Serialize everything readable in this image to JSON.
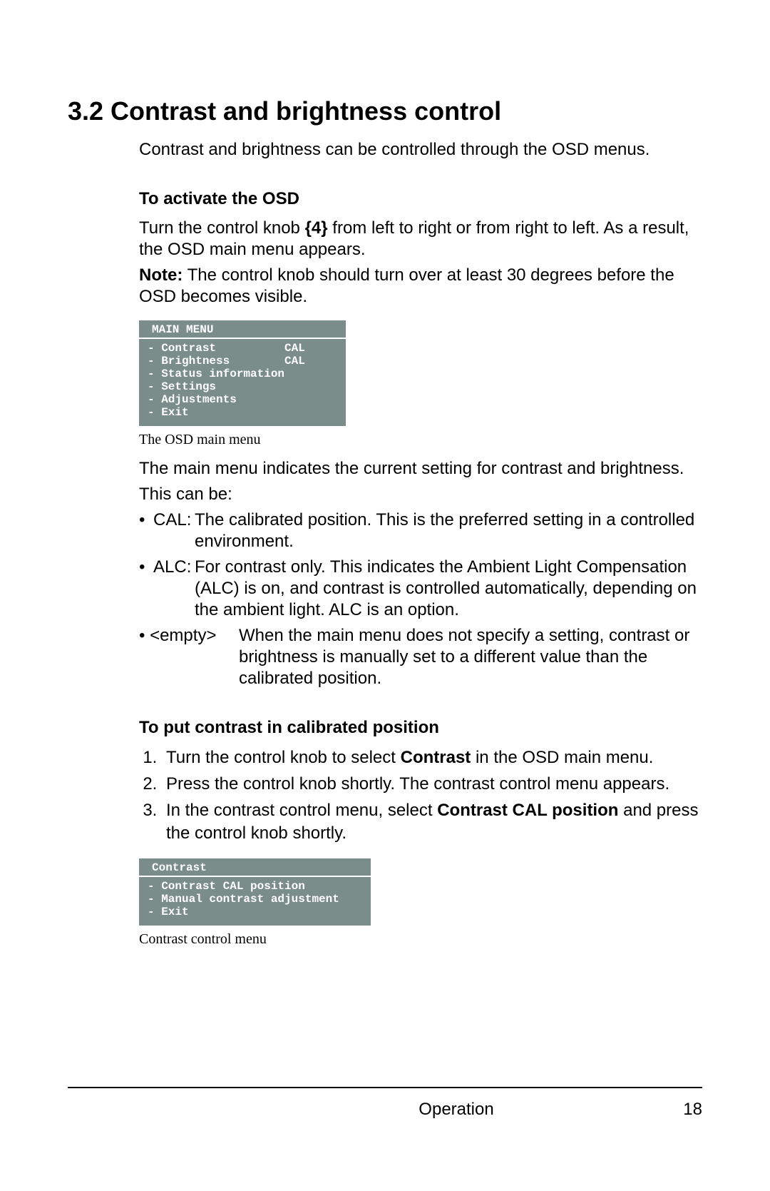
{
  "section": {
    "title": "3.2 Contrast and brightness control",
    "intro": "Contrast and brightness can be controlled through the OSD menus."
  },
  "activate": {
    "heading": "To activate the OSD",
    "p1a": "Turn the control knob ",
    "p1b": "{4}",
    "p1c": " from left to right or from right to left. As a result, the OSD main menu appears.",
    "note_label": "Note:",
    "note_text": " The control knob should turn over at least 30 degrees before the OSD becomes visible.",
    "caption": "The OSD main menu",
    "after1": "The main menu indicates the current setting for contrast and brightness.",
    "after2": "This can be:"
  },
  "osd_main": {
    "header": "MAIN MENU",
    "lines": [
      "- Contrast          CAL",
      "- Brightness        CAL",
      "- Status information",
      "- Settings",
      "- Adjustments",
      "- Exit"
    ]
  },
  "defs": {
    "cal_term": "CAL:",
    "cal_text": "The calibrated position. This is the preferred setting in a controlled environment.",
    "alc_term": "ALC:",
    "alc_text": "For contrast only. This indicates the Ambient Light Compensation (ALC) is on, and contrast is controlled automatically, depending on the ambient light. ALC is an option.",
    "empty_term": "• <empty>",
    "empty_text": "When the main menu does not specify a setting, contrast or brightness is manually set to a different value than the calibrated position."
  },
  "calibrate": {
    "heading": "To put contrast in calibrated position",
    "s1a": "Turn the control knob  to select ",
    "s1b": "Contrast",
    "s1c": " in the OSD main menu.",
    "s2": "Press the control knob shortly. The contrast control menu appears.",
    "s3a": "In the contrast control menu, select ",
    "s3b": "Contrast CAL position",
    "s3c": " and press the control knob shortly.",
    "caption": "Contrast control menu"
  },
  "osd_contrast": {
    "header": "Contrast",
    "lines": [
      "- Contrast CAL position",
      "- Manual contrast adjustment",
      "- Exit"
    ]
  },
  "footer": {
    "label": "Operation",
    "page": "18"
  }
}
